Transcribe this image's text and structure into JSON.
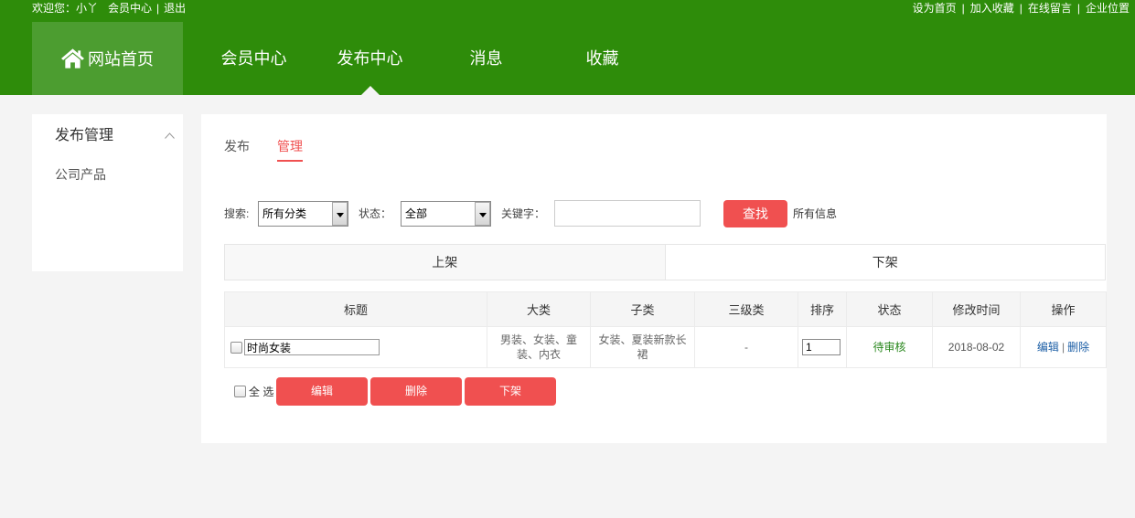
{
  "topbar": {
    "welcome": "欢迎您：小丫",
    "member_center": "会员中心",
    "sep": "|",
    "logout": "退出",
    "links": [
      "设为首页",
      "加入收藏",
      "在线留言",
      "企业位置"
    ]
  },
  "nav": {
    "home": "网站首页",
    "items": [
      "会员中心",
      "发布中心",
      "消息",
      "收藏"
    ],
    "active_index": 1
  },
  "sidebar": {
    "title": "发布管理",
    "items": [
      "公司产品"
    ]
  },
  "tabs": {
    "items": [
      "发布",
      "管理"
    ],
    "active_index": 1
  },
  "search": {
    "label": "搜索:",
    "category_value": "所有分类",
    "status_label": "状态：",
    "status_value": "全部",
    "keyword_label": "关键字：",
    "keyword_value": "",
    "submit": "查找",
    "all_info": "所有信息"
  },
  "status_tabs": {
    "items": [
      "上架",
      "下架"
    ],
    "active_index": 0
  },
  "table": {
    "headers": [
      "标题",
      "大类",
      "子类",
      "三级类",
      "排序",
      "状态",
      "修改时间",
      "操作"
    ],
    "rows": [
      {
        "checked": false,
        "title": "时尚女装",
        "category": "男装、女装、童装、内衣",
        "subcategory": "女装、夏装新款长裙",
        "level3": "-",
        "sort": "1",
        "status": "待审核",
        "modified": "2018-08-02",
        "actions": [
          "编辑",
          "删除"
        ],
        "action_sep": "|"
      }
    ]
  },
  "bulk": {
    "select_all_checked": false,
    "select_all": "全 选",
    "buttons": [
      "编辑",
      "删除",
      "下架"
    ]
  },
  "icons": {
    "home": "home-icon",
    "sidebar_toggle": "chevron-up-icon",
    "select_arrow": "chevron-down-icon"
  },
  "colors": {
    "header_green": "#2e8c0a",
    "home_green": "#4c9d30",
    "page_bg": "#f4f4f4",
    "accent_red": "#f05050",
    "status_green": "#28871c",
    "link_blue": "#1d5fa6"
  }
}
